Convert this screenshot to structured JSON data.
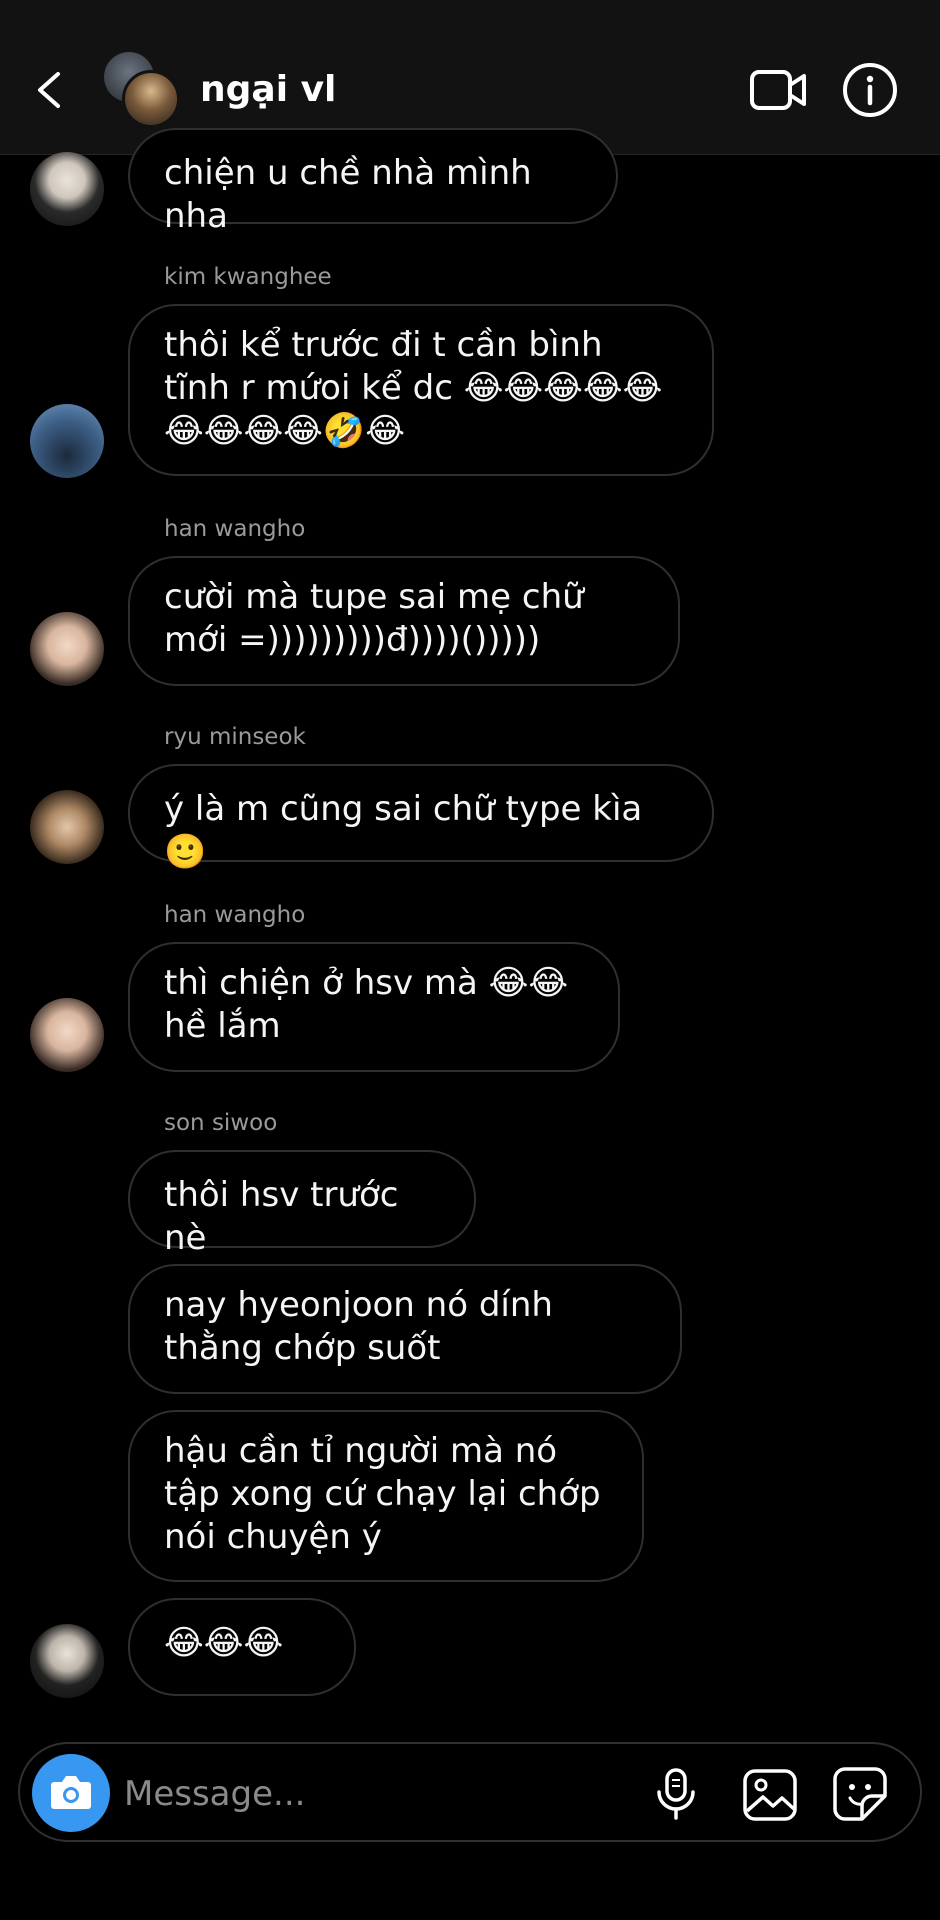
{
  "header": {
    "title": "ngại vl",
    "back_icon": "chevron-left-icon",
    "video_icon": "video-camera-icon",
    "info_icon": "info-icon"
  },
  "messages": [
    {
      "sender": "",
      "text": "chiện u chề nhà mình nha"
    },
    {
      "sender": "kim kwanghee",
      "text": "thôi kể trước đi t cần bình tĩnh r mứoi kể dc 😂😂😂😂😂😂😂😂😂🤣😂"
    },
    {
      "sender": "han wangho",
      "text": "cười mà tupe sai mẹ chữ mới =)))))))))đ))))()))))"
    },
    {
      "sender": "ryu minseok",
      "text": "ý là m cũng sai chữ type kìa 🙂"
    },
    {
      "sender": "han wangho",
      "text": "thì chiện ở hsv mà 😂😂 hề lắm"
    },
    {
      "sender": "son siwoo",
      "text": "thôi hsv trước nè"
    },
    {
      "sender": "",
      "text": "nay hyeonjoon nó dính thằng chớp suốt"
    },
    {
      "sender": "",
      "text": "hậu cần tỉ người mà nó tập xong cứ chạy lại chớp nói chuyện ý"
    },
    {
      "sender": "",
      "text": "😂😂😂"
    }
  ],
  "composer": {
    "placeholder": "Message...",
    "camera_icon": "camera-icon",
    "mic_icon": "microphone-icon",
    "gallery_icon": "image-icon",
    "sticker_icon": "sticker-icon",
    "accent": "#3897f0"
  }
}
